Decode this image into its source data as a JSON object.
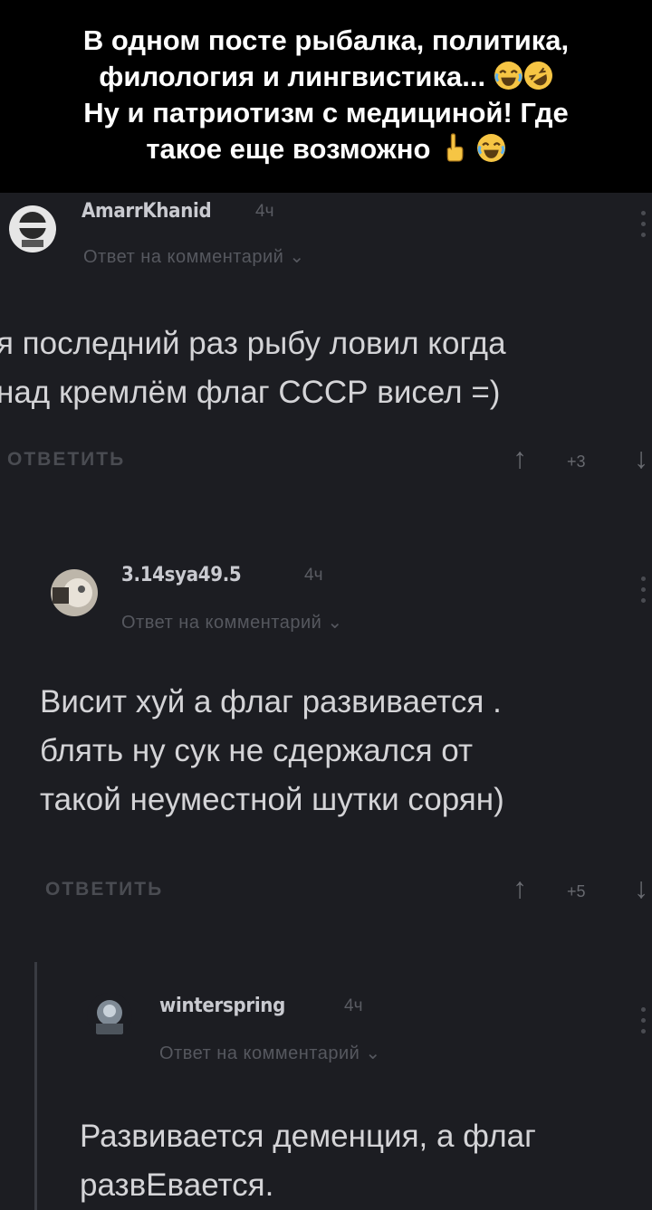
{
  "header": {
    "line1": "В одном посте рыбалка, политика,",
    "line2": "филология и лингвистика...",
    "line3": "Ну и патриотизм с медициной! Где",
    "line4": "такое еще возможно"
  },
  "comments": [
    {
      "username": "AmarrKhanid",
      "time": "4ч",
      "reply_label": "Ответ на комментарий",
      "lines": [
        "я последний раз рыбу ловил когда",
        "над кремлём флаг СССР висел =)"
      ],
      "reply_button": "ОТВЕТИТЬ",
      "score": "+3"
    },
    {
      "username": "3.14sya49.5",
      "time": "4ч",
      "reply_label": "Ответ на комментарий",
      "lines": [
        "Висит хуй а флаг развивается .",
        "блять ну сук не сдержался от",
        "такой неуместной шутки сорян)"
      ],
      "reply_button": "ОТВЕТИТЬ",
      "score": "+5"
    },
    {
      "username": "winterspring",
      "time": "4ч",
      "reply_label": "Ответ на комментарий",
      "lines": [
        "Развивается деменция, а флаг",
        "развЕвается."
      ]
    }
  ],
  "icons": {
    "kebab": "more-vertical-icon",
    "upvote": "arrow-up-icon",
    "downvote": "arrow-down-icon",
    "chevron": "chevron-down-icon"
  }
}
